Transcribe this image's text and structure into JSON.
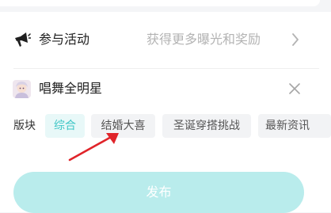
{
  "activity": {
    "title": "参与活动",
    "hint": "获得更多曝光和奖励"
  },
  "community": {
    "name": "唱舞全明星"
  },
  "sections": {
    "label": "版块",
    "chips": [
      {
        "label": "综合",
        "selected": true
      },
      {
        "label": "结婚大喜",
        "selected": false
      },
      {
        "label": "圣诞穿搭挑战",
        "selected": false
      },
      {
        "label": "最新资讯",
        "selected": false
      }
    ]
  },
  "publish": {
    "label": "发布"
  },
  "colors": {
    "accent": "#3ec6c6",
    "publish_bg": "#b9ecec",
    "annotation_arrow": "#e0242a"
  },
  "icons": {
    "activity": "megaphone-icon",
    "more": "chevron-right-icon",
    "remove": "close-icon",
    "annotation": "red-arrow-annotation"
  }
}
